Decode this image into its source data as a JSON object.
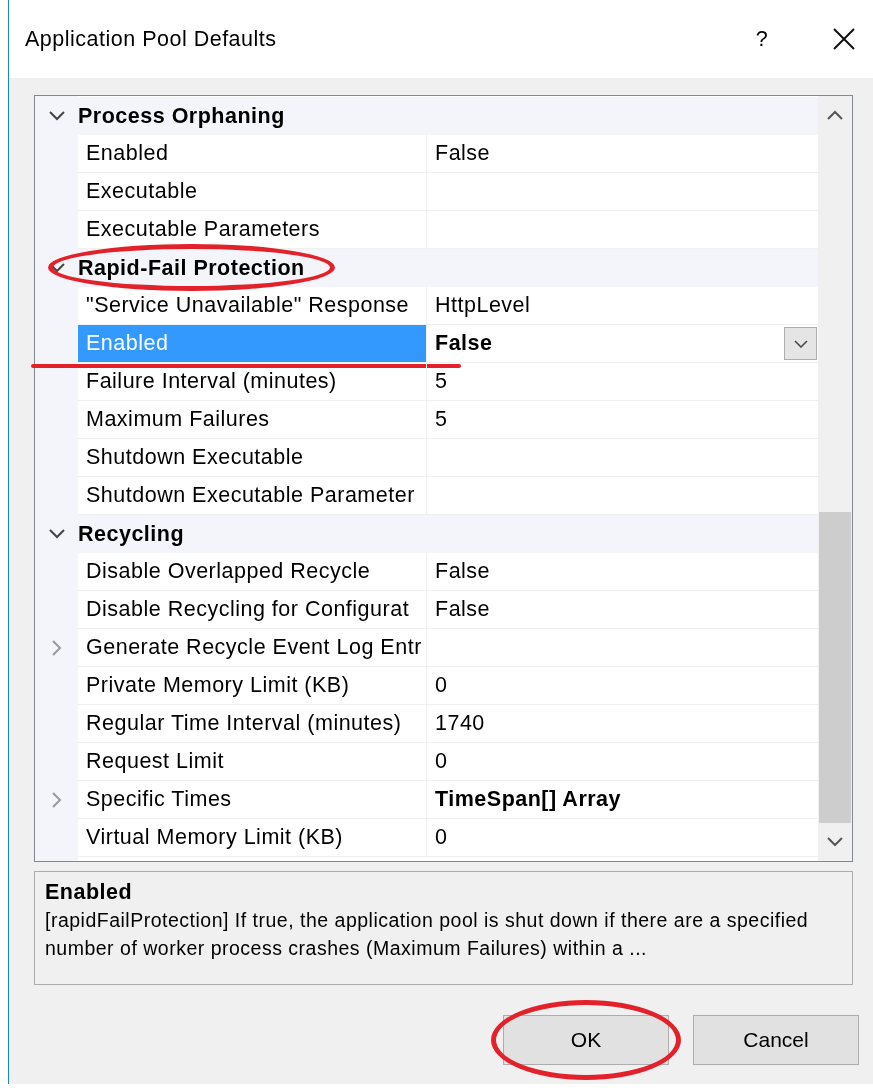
{
  "window": {
    "title": "Application Pool Defaults",
    "help": "?"
  },
  "categories": [
    {
      "label": "Process Orphaning",
      "expanded": true,
      "circled": false,
      "rows": [
        {
          "name": "Enabled",
          "value": "False",
          "non_default": false,
          "expandable": false,
          "selected": false,
          "underlined": false
        },
        {
          "name": "Executable",
          "expandable": false,
          "selected": false,
          "underlined": false
        },
        {
          "name": "Executable Parameters",
          "expandable": false,
          "selected": false,
          "underlined": false
        }
      ]
    },
    {
      "label": "Rapid-Fail Protection",
      "expanded": true,
      "circled": true,
      "rows": [
        {
          "name": "\"Service Unavailable\" Response",
          "value": "HttpLevel",
          "non_default": false,
          "expandable": false,
          "selected": false,
          "underlined": false
        },
        {
          "name": "Enabled",
          "value": "False",
          "non_default": true,
          "expandable": false,
          "selected": true,
          "underlined": true
        },
        {
          "name": "Failure Interval (minutes)",
          "value": "5",
          "non_default": false,
          "expandable": false,
          "selected": false,
          "underlined": false
        },
        {
          "name": "Maximum Failures",
          "value": "5",
          "non_default": false,
          "expandable": false,
          "selected": false,
          "underlined": false
        },
        {
          "name": "Shutdown Executable",
          "expandable": false,
          "selected": false,
          "underlined": false
        },
        {
          "name": "Shutdown Executable Parameter",
          "expandable": false,
          "selected": false,
          "underlined": false
        }
      ]
    },
    {
      "label": "Recycling",
      "expanded": true,
      "circled": false,
      "rows": [
        {
          "name": "Disable Overlapped Recycle",
          "value": "False",
          "non_default": false,
          "expandable": false,
          "selected": false,
          "underlined": false
        },
        {
          "name": "Disable Recycling for Configurat",
          "value": "False",
          "non_default": false,
          "expandable": false,
          "selected": false,
          "underlined": false
        },
        {
          "name": "Generate Recycle Event Log Entr",
          "expandable": true,
          "selected": false,
          "underlined": false
        },
        {
          "name": "Private Memory Limit (KB)",
          "value": "0",
          "non_default": false,
          "expandable": false,
          "selected": false,
          "underlined": false
        },
        {
          "name": "Regular Time Interval (minutes)",
          "value": "1740",
          "non_default": false,
          "expandable": false,
          "selected": false,
          "underlined": false
        },
        {
          "name": "Request Limit",
          "value": "0",
          "non_default": false,
          "expandable": false,
          "selected": false,
          "underlined": false
        },
        {
          "name": "Specific Times",
          "value": "TimeSpan[] Array",
          "non_default": true,
          "expandable": true,
          "selected": false,
          "underlined": false
        },
        {
          "name": "Virtual Memory Limit (KB)",
          "value": "0",
          "non_default": false,
          "expandable": false,
          "selected": false,
          "underlined": false
        }
      ]
    }
  ],
  "description": {
    "title": "Enabled",
    "text": "[rapidFailProtection] If true, the application pool is shut down if there are a specified number of worker process crashes (Maximum Failures) within a ..."
  },
  "buttons": [
    {
      "label": "OK",
      "circled": true
    },
    {
      "label": "Cancel",
      "circled": false
    }
  ]
}
